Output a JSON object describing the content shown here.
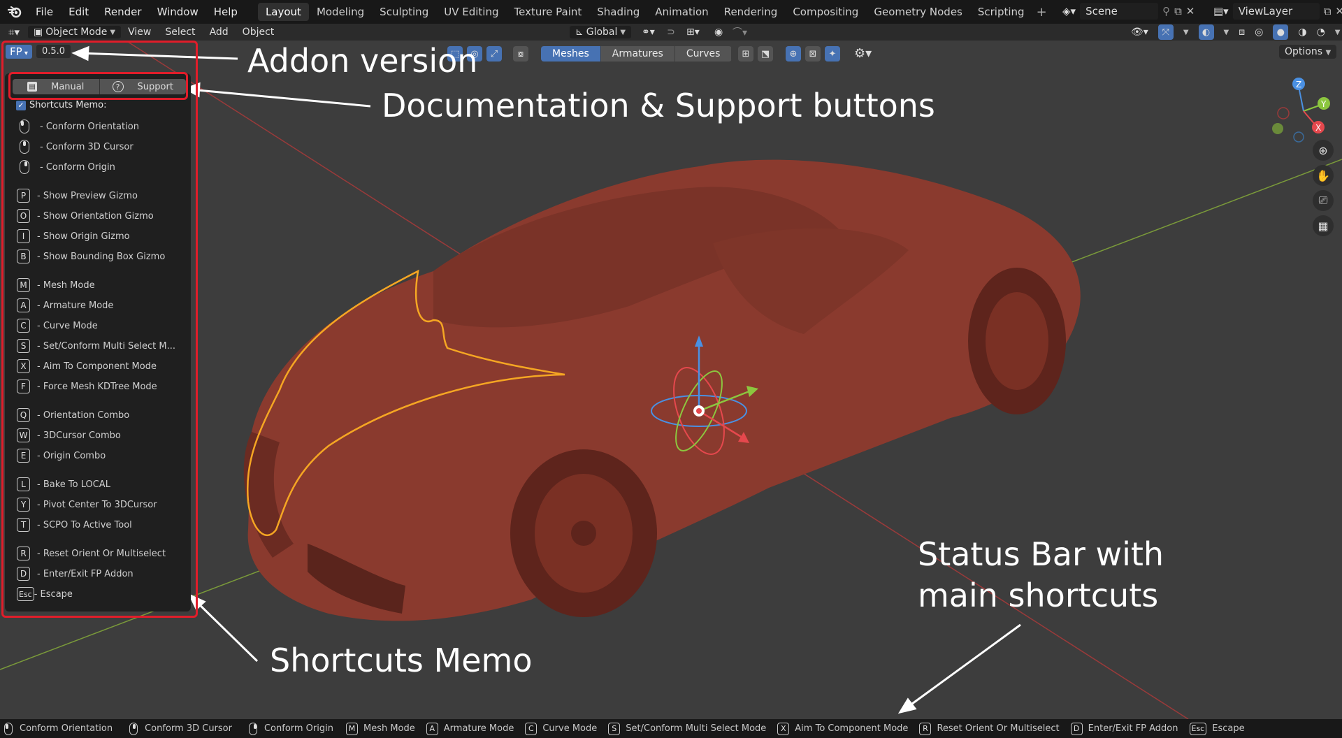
{
  "menus": [
    "File",
    "Edit",
    "Render",
    "Window",
    "Help"
  ],
  "workspace_tabs": [
    "Layout",
    "Modeling",
    "Sculpting",
    "UV Editing",
    "Texture Paint",
    "Shading",
    "Animation",
    "Rendering",
    "Compositing",
    "Geometry Nodes",
    "Scripting"
  ],
  "active_tab": "Layout",
  "scene": "Scene",
  "view_layer": "ViewLayer",
  "header": {
    "mode": "Object Mode",
    "view": "View",
    "select": "Select",
    "add": "Add",
    "object": "Object",
    "transform_orientation": "Global",
    "options": "Options"
  },
  "tool_toggles": [
    "Meshes",
    "Armatures",
    "Curves"
  ],
  "addon": {
    "badge": "FP",
    "version": "0.5.0",
    "manual_label": "Manual",
    "support_label": "Support",
    "memo_label": "Shortcuts Memo:",
    "memo_checked": true
  },
  "memo_mouse_items": [
    {
      "button": "left",
      "label": "- Conform Orientation"
    },
    {
      "button": "middle",
      "label": "- Conform 3D Cursor"
    },
    {
      "button": "right",
      "label": "- Conform Origin"
    }
  ],
  "memo_key_items": [
    {
      "key": "P",
      "label": "- Show Preview Gizmo"
    },
    {
      "key": "O",
      "label": "- Show Orientation Gizmo"
    },
    {
      "key": "I",
      "label": "- Show Origin Gizmo"
    },
    {
      "key": "B",
      "label": "- Show Bounding Box Gizmo"
    },
    {
      "key": "M",
      "label": "- Mesh Mode"
    },
    {
      "key": "A",
      "label": "- Armature Mode"
    },
    {
      "key": "C",
      "label": "- Curve Mode"
    },
    {
      "key": "S",
      "label": "- Set/Conform Multi Select M..."
    },
    {
      "key": "X",
      "label": "- Aim To Component Mode"
    },
    {
      "key": "F",
      "label": "- Force Mesh KDTree Mode"
    },
    {
      "key": "Q",
      "label": "- Orientation Combo"
    },
    {
      "key": "W",
      "label": "- 3DCursor Combo"
    },
    {
      "key": "E",
      "label": "- Origin Combo"
    },
    {
      "key": "L",
      "label": "- Bake To LOCAL"
    },
    {
      "key": "Y",
      "label": "- Pivot Center To 3DCursor"
    },
    {
      "key": "T",
      "label": "- SCPO To Active Tool"
    },
    {
      "key": "R",
      "label": "- Reset Orient Or Multiselect"
    },
    {
      "key": "D",
      "label": "- Enter/Exit FP Addon"
    },
    {
      "key": "Esc",
      "label": "- Escape"
    }
  ],
  "annotations": {
    "addon_version": "Addon version",
    "doc_support": "Documentation & Support buttons",
    "memo": "Shortcuts Memo",
    "status_line1": "Status Bar with",
    "status_line2": "main shortcuts"
  },
  "gizmo_axes": {
    "x": "X",
    "y": "Y",
    "z": "Z"
  },
  "status_mouse_items": [
    {
      "button": "left",
      "label": "Conform Orientation"
    },
    {
      "button": "middle",
      "label": "Conform 3D Cursor"
    },
    {
      "button": "right",
      "label": "Conform Origin"
    }
  ],
  "status_key_items": [
    {
      "key": "M",
      "label": "Mesh Mode"
    },
    {
      "key": "A",
      "label": "Armature Mode"
    },
    {
      "key": "C",
      "label": "Curve Mode"
    },
    {
      "key": "S",
      "label": "Set/Conform Multi Select Mode"
    },
    {
      "key": "X",
      "label": "Aim To Component Mode"
    },
    {
      "key": "R",
      "label": "Reset Orient Or Multiselect"
    },
    {
      "key": "D",
      "label": "Enter/Exit FP Addon"
    },
    {
      "key": "Esc",
      "label": "Escape"
    }
  ],
  "colors": {
    "accent": "#4772b3",
    "annotation_red": "#e11d2a",
    "car_body": "#8a3a2e",
    "selection_outline": "#f5a623",
    "axis_x": "#e5484d",
    "axis_y": "#8cc63f",
    "axis_z": "#4a90e2"
  }
}
